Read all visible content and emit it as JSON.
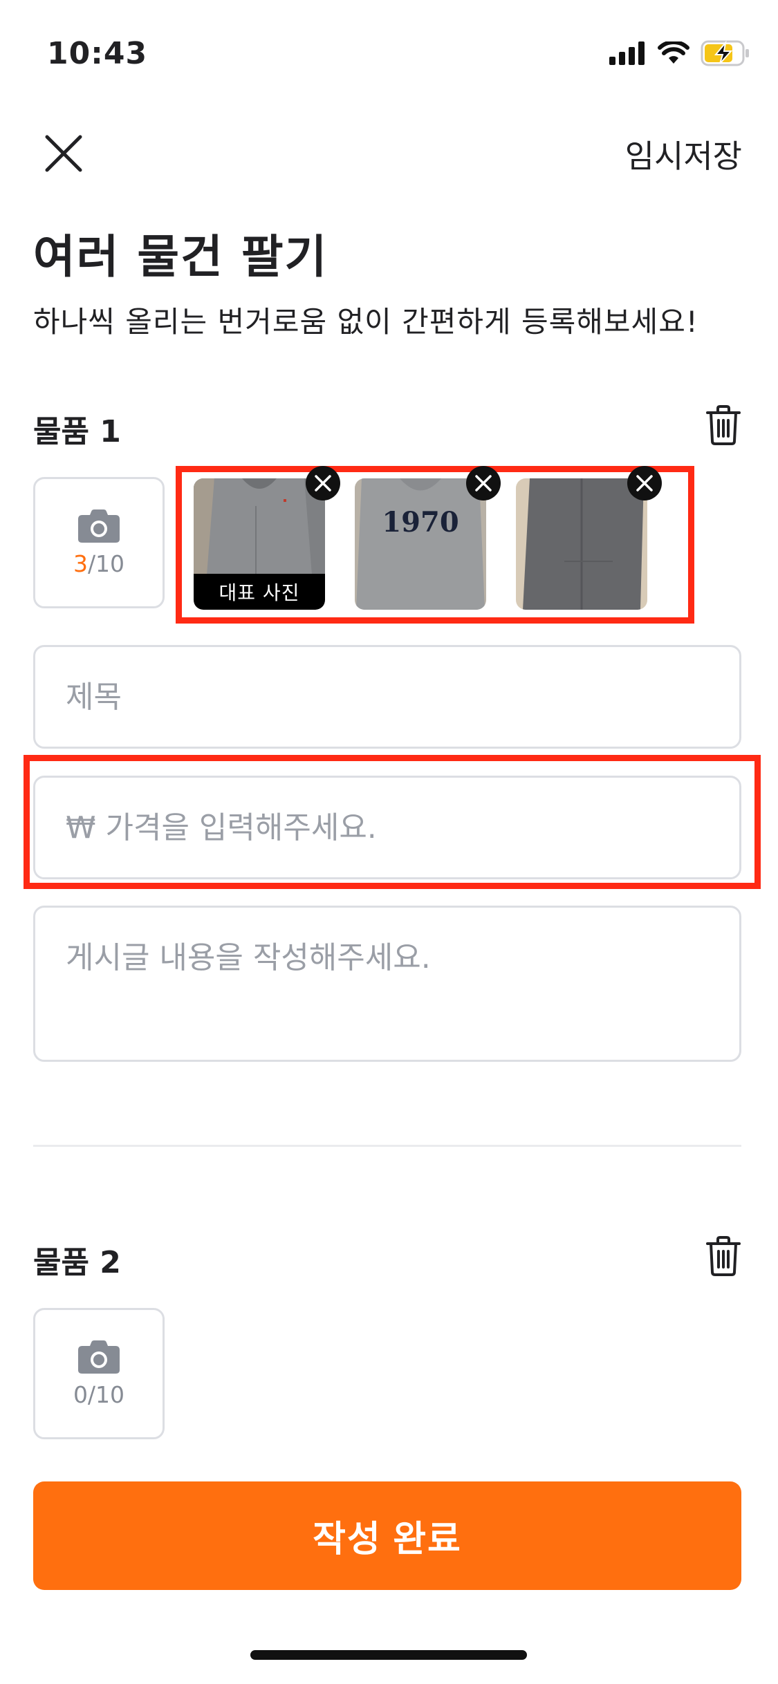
{
  "status_bar": {
    "time": "10:43"
  },
  "nav": {
    "close_icon": "close-icon",
    "temp_save_label": "임시저장"
  },
  "header": {
    "title": "여러 물건 팔기",
    "subtitle": "하나씩 올리는 번거로움 없이 간편하게 등록해보세요!"
  },
  "items": [
    {
      "title": "물품 1",
      "photo_current": "3",
      "photo_total": "/10",
      "photos": [
        {
          "representative_label": "대표 사진"
        },
        {
          "print_text": "1970"
        },
        {}
      ],
      "title_placeholder": "제목",
      "price_placeholder": "₩ 가격을 입력해주세요.",
      "content_placeholder": "게시글 내용을 작성해주세요."
    },
    {
      "title": "물품 2",
      "photo_count": "0/10"
    }
  ],
  "submit_label": "작성 완료",
  "colors": {
    "accent": "#ff6f0f",
    "highlight": "#ff2a14"
  }
}
